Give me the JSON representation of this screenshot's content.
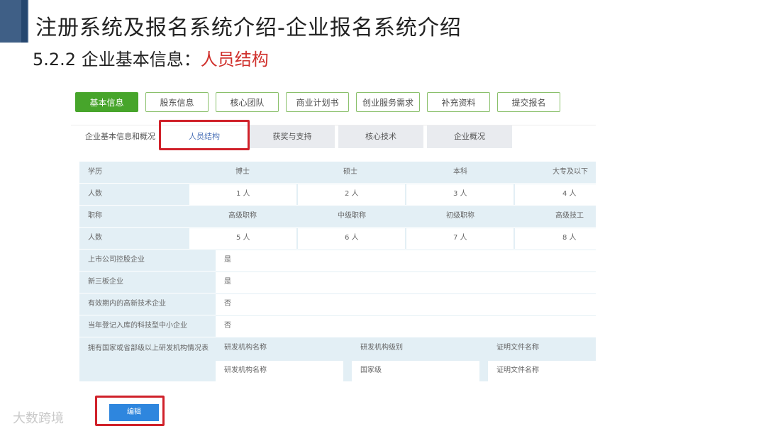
{
  "slide": {
    "title": "注册系统及报名系统介绍-企业报名系统介绍",
    "subtitle_prefix": "5.2.2 企业基本信息：",
    "subtitle_highlight": "人员结构",
    "watermark": "大数跨境"
  },
  "top_tabs": [
    "基本信息",
    "股东信息",
    "核心团队",
    "商业计划书",
    "创业服务需求",
    "补充资料",
    "提交报名"
  ],
  "sub_tabs": [
    "企业基本信息和概况",
    "人员结构",
    "获奖与支持",
    "核心技术",
    "企业概况"
  ],
  "education": {
    "label": "学历",
    "headers": [
      "博士",
      "硕士",
      "本科",
      "大专及以下"
    ],
    "count_label": "人数",
    "counts": [
      "1 人",
      "2 人",
      "3 人",
      "4 人"
    ]
  },
  "title_section": {
    "label": "职称",
    "headers": [
      "高级职称",
      "中级职称",
      "初级职称",
      "高级技工"
    ],
    "count_label": "人数",
    "counts": [
      "5 人",
      "6 人",
      "7 人",
      "8 人"
    ]
  },
  "fields": [
    {
      "label": "上市公司控股企业",
      "value": "是"
    },
    {
      "label": "新三板企业",
      "value": "是"
    },
    {
      "label": "有效期内的高新技术企业",
      "value": "否"
    },
    {
      "label": "当年登记入库的科技型中小企业",
      "value": "否"
    }
  ],
  "rd": {
    "label": "拥有国家或省部级以上研发机构情况表",
    "headers": [
      "研发机构名称",
      "研发机构级别",
      "证明文件名称"
    ],
    "values": [
      "研发机构名称",
      "国家级",
      "证明文件名称"
    ]
  },
  "edit_button": "编辑"
}
